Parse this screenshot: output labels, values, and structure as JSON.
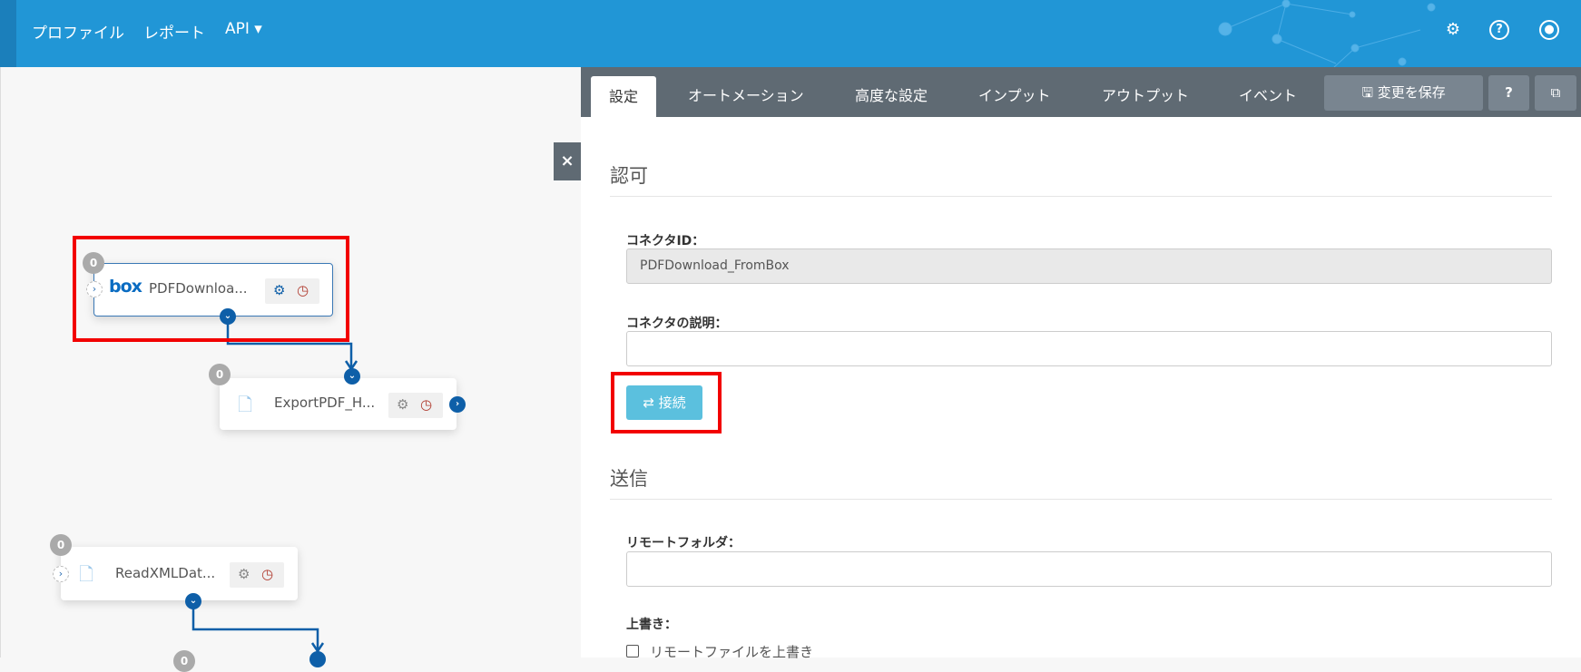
{
  "header": {
    "nav": [
      "プロファイル",
      "レポート",
      "API ▾"
    ],
    "icons": [
      "gear-icon",
      "help-icon",
      "user-icon"
    ]
  },
  "canvas": {
    "nodes": [
      {
        "name": "PDFDownloa...",
        "badge": "0",
        "icon": "box"
      },
      {
        "name": "ExportPDF_H...",
        "badge": "0"
      },
      {
        "name": "ReadXMLDat...",
        "badge": "0"
      },
      {
        "badge": "0"
      }
    ],
    "close": "×"
  },
  "panel": {
    "tabs": [
      "設定",
      "オートメーション",
      "高度な設定",
      "インプット",
      "アウトプット",
      "イベント"
    ],
    "save": "変更を保存",
    "help": "?",
    "external": "⧉",
    "auth": {
      "heading": "認可",
      "connector_id_label": "コネクタID：",
      "connector_id": "PDFDownload_FromBox",
      "desc_label": "コネクタの説明：",
      "desc": "",
      "connect": "⇄ 接続"
    },
    "send": {
      "heading": "送信",
      "remote_folder_label": "リモートフォルダ：",
      "remote_folder": "",
      "overwrite_label": "上書き：",
      "overwrite_checkbox": "リモートファイルを上書き"
    }
  },
  "colors": {
    "header": "#2196d6",
    "tabbar": "#5f6a73",
    "accent": "#0e5fa8",
    "connect": "#5bc0de",
    "highlight": "#f20000"
  }
}
